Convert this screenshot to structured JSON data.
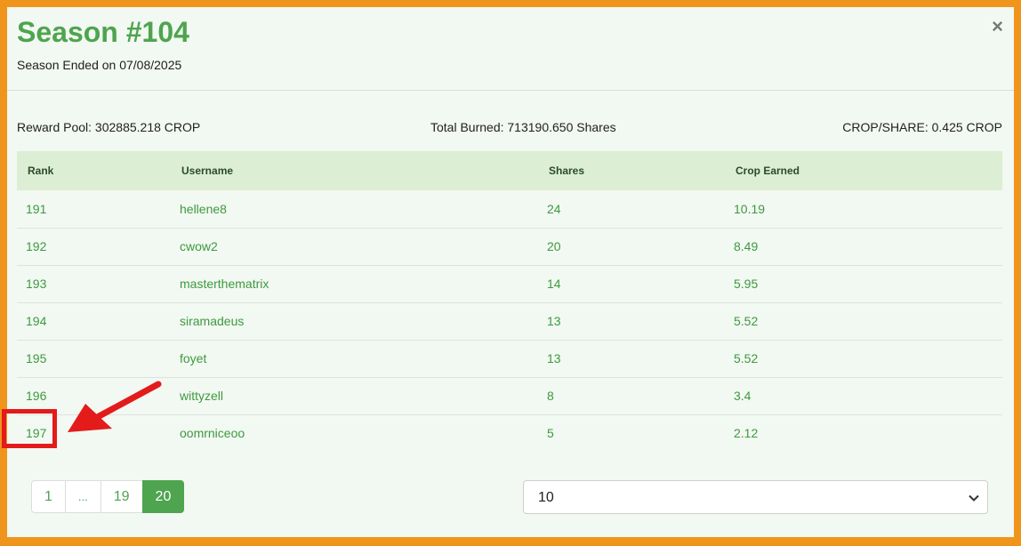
{
  "header": {
    "title": "Season #104",
    "subtitle": "Season Ended on 07/08/2025",
    "close_label": "×"
  },
  "stats": {
    "reward_pool": "Reward Pool: 302885.218 CROP",
    "total_burned": "Total Burned: 713190.650 Shares",
    "crop_per_share": "CROP/SHARE: 0.425 CROP"
  },
  "table": {
    "columns": [
      "Rank",
      "Username",
      "Shares",
      "Crop Earned"
    ],
    "rows": [
      [
        "191",
        "hellene8",
        "24",
        "10.19"
      ],
      [
        "192",
        "cwow2",
        "20",
        "8.49"
      ],
      [
        "193",
        "masterthematrix",
        "14",
        "5.95"
      ],
      [
        "194",
        "siramadeus",
        "13",
        "5.52"
      ],
      [
        "195",
        "foyet",
        "13",
        "5.52"
      ],
      [
        "196",
        "wittyzell",
        "8",
        "3.4"
      ],
      [
        "197",
        "oomrniceoo",
        "5",
        "2.12"
      ]
    ]
  },
  "pagination": {
    "pages": [
      "1",
      "...",
      "19",
      "20"
    ],
    "active": "20"
  },
  "page_size": {
    "selected": "10"
  },
  "annotation": {
    "color": "#e31b1b"
  },
  "colors": {
    "accent": "#4ea44f",
    "frame": "#f0951b",
    "header_row": "#dcefd4"
  }
}
